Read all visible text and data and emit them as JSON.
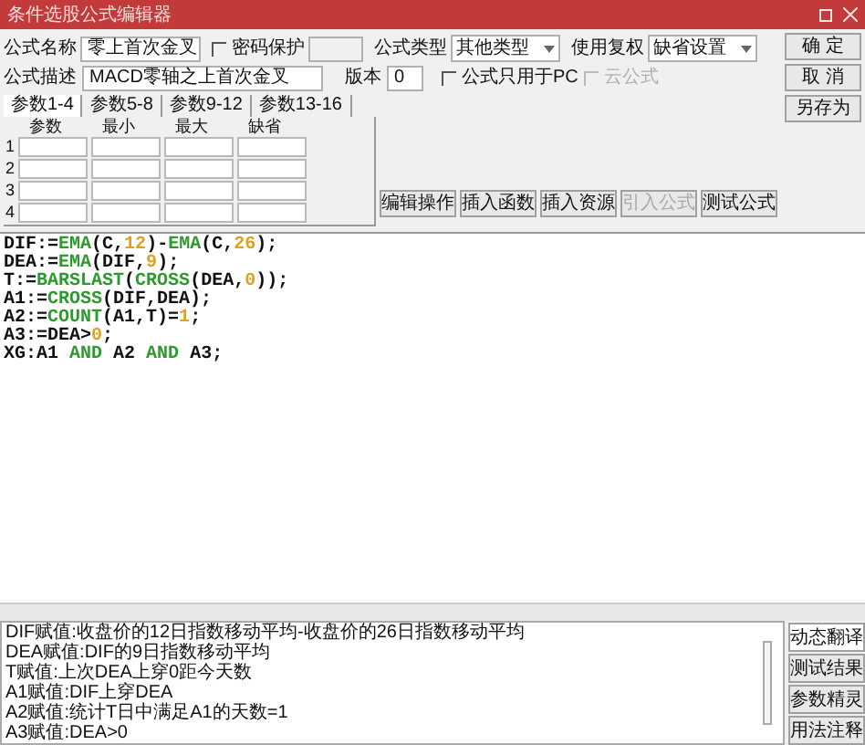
{
  "window": {
    "title": "条件选股公式编辑器"
  },
  "form": {
    "name_label": "公式名称",
    "name_value": "零上首次金叉",
    "password": {
      "label": "密码保护",
      "checked": false
    },
    "type_label": "公式类型",
    "type_value": "其他类型",
    "rights_label": "使用复权",
    "rights_value": "缺省设置",
    "desc_label": "公式描述",
    "desc_value": "MACD零轴之上首次金叉",
    "version_label": "版本",
    "version_value": "0",
    "pc_only": {
      "label": "公式只用于PC",
      "checked": false
    },
    "cloud": {
      "label": "云公式",
      "checked": false,
      "disabled": true
    }
  },
  "side_buttons": [
    "确 定",
    "取 消",
    "另存为"
  ],
  "tabs": [
    {
      "label": "参数1-4",
      "selected": true
    },
    {
      "label": "参数5-8",
      "selected": false
    },
    {
      "label": "参数9-12",
      "selected": false
    },
    {
      "label": "参数13-16",
      "selected": false
    }
  ],
  "params": {
    "columns": [
      "参数",
      "最小",
      "最大",
      "缺省"
    ],
    "rows": [
      "1",
      "2",
      "3",
      "4"
    ]
  },
  "action_buttons": [
    {
      "label": "编辑操作",
      "disabled": false
    },
    {
      "label": "插入函数",
      "disabled": false
    },
    {
      "label": "插入资源",
      "disabled": false
    },
    {
      "label": "引入公式",
      "disabled": true
    },
    {
      "label": "测试公式",
      "disabled": false
    }
  ],
  "code": [
    [
      {
        "kind": "plain",
        "text": "DIF:="
      },
      {
        "kind": "func",
        "text": "EMA"
      },
      {
        "kind": "plain",
        "text": "(C,"
      },
      {
        "kind": "num",
        "text": "12"
      },
      {
        "kind": "plain",
        "text": ")-"
      },
      {
        "kind": "func",
        "text": "EMA"
      },
      {
        "kind": "plain",
        "text": "(C,"
      },
      {
        "kind": "num",
        "text": "26"
      },
      {
        "kind": "plain",
        "text": ");"
      }
    ],
    [
      {
        "kind": "plain",
        "text": "DEA:="
      },
      {
        "kind": "func",
        "text": "EMA"
      },
      {
        "kind": "plain",
        "text": "(DIF,"
      },
      {
        "kind": "num",
        "text": "9"
      },
      {
        "kind": "plain",
        "text": ");"
      }
    ],
    [
      {
        "kind": "plain",
        "text": "T:="
      },
      {
        "kind": "func",
        "text": "BARSLAST"
      },
      {
        "kind": "plain",
        "text": "("
      },
      {
        "kind": "func",
        "text": "CROSS"
      },
      {
        "kind": "plain",
        "text": "(DEA,"
      },
      {
        "kind": "num",
        "text": "0"
      },
      {
        "kind": "plain",
        "text": "));"
      }
    ],
    [
      {
        "kind": "plain",
        "text": "A1:="
      },
      {
        "kind": "func",
        "text": "CROSS"
      },
      {
        "kind": "plain",
        "text": "(DIF,DEA);"
      }
    ],
    [
      {
        "kind": "plain",
        "text": "A2:="
      },
      {
        "kind": "func",
        "text": "COUNT"
      },
      {
        "kind": "plain",
        "text": "(A1,T)="
      },
      {
        "kind": "num",
        "text": "1"
      },
      {
        "kind": "plain",
        "text": ";"
      }
    ],
    [
      {
        "kind": "plain",
        "text": "A3:=DEA>"
      },
      {
        "kind": "num",
        "text": "0"
      },
      {
        "kind": "plain",
        "text": ";"
      }
    ],
    [
      {
        "kind": "plain",
        "text": "XG:A1 "
      },
      {
        "kind": "func",
        "text": "AND"
      },
      {
        "kind": "plain",
        "text": " A2 "
      },
      {
        "kind": "func",
        "text": "AND"
      },
      {
        "kind": "plain",
        "text": " A3;"
      }
    ]
  ],
  "explanation": [
    "DIF赋值:收盘价的12日指数移动平均-收盘价的26日指数移动平均",
    "DEA赋值:DIF的9日指数移动平均",
    "T赋值:上次DEA上穿0距今天数",
    "A1赋值:DIF上穿DEA",
    "A2赋值:统计T日中满足A1的天数=1",
    "A3赋值:DEA>0"
  ],
  "bottom_buttons": [
    {
      "label": "动态翻译",
      "selected": true
    },
    {
      "label": "测试结果",
      "selected": false
    },
    {
      "label": "参数精灵",
      "selected": false
    },
    {
      "label": "用法注释",
      "selected": false
    }
  ]
}
